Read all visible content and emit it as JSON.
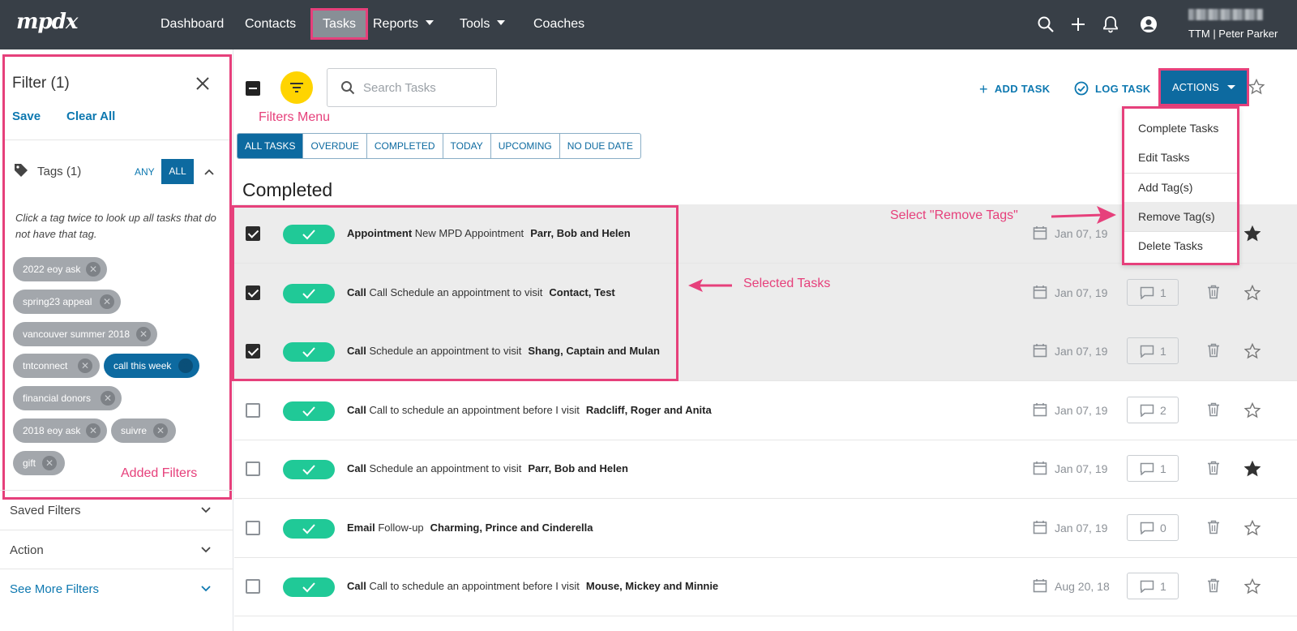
{
  "nav": {
    "logo": "mpdx",
    "items": [
      "Dashboard",
      "Contacts",
      "Tasks",
      "Reports",
      "Tools",
      "Coaches"
    ],
    "account_name": "TTM | Peter Parker",
    "icons": [
      "search-icon",
      "plus-icon",
      "bell-icon",
      "user-icon"
    ]
  },
  "sidebar": {
    "title": "Filter (1)",
    "save": "Save",
    "clear_all": "Clear All",
    "tags_label": "Tags (1)",
    "any": "ANY",
    "all": "ALL",
    "hint": "Click a tag twice to look up all tasks that do not have that tag.",
    "tags": [
      "2022 eoy ask",
      "spring23 appeal",
      "vancouver summer 2018",
      "tntconnect",
      "call this week",
      "financial donors",
      "2018 eoy ask",
      "suivre",
      "gift"
    ],
    "active_tag": "call this week",
    "added_filters_note": "Added Filters",
    "sections": [
      "Saved Filters",
      "Action",
      "See More Filters"
    ]
  },
  "main": {
    "filters_menu_note": "Filters Menu",
    "search_placeholder": "Search Tasks",
    "add_task": "ADD TASK",
    "log_task": "LOG TASK",
    "actions": "ACTIONS",
    "tabs": [
      "ALL TASKS",
      "OVERDUE",
      "COMPLETED",
      "TODAY",
      "UPCOMING",
      "NO DUE DATE"
    ],
    "section_title": "Completed",
    "selected_tasks_note": "Selected Tasks",
    "remove_tags_note": "Select \"Remove Tags\"",
    "dropdown": [
      "Complete Tasks",
      "Edit Tasks",
      "Add Tag(s)",
      "Remove Tag(s)",
      "Delete Tasks"
    ],
    "tasks": [
      {
        "type": "Appointment",
        "subject": "New MPD Appointment",
        "contact": "Parr, Bob and Helen",
        "date": "Jan 07, 19",
        "comments": "",
        "selected": true,
        "starred": true
      },
      {
        "type": "Call",
        "subject": "Call Schedule an appointment to visit",
        "contact": "Contact, Test",
        "date": "Jan 07, 19",
        "comments": "1",
        "selected": true,
        "starred": false
      },
      {
        "type": "Call",
        "subject": "Schedule an appointment to visit",
        "contact": "Shang, Captain and Mulan",
        "date": "Jan 07, 19",
        "comments": "1",
        "selected": true,
        "starred": false
      },
      {
        "type": "Call",
        "subject": "Call to schedule an appointment before I visit",
        "contact": "Radcliff, Roger and Anita",
        "date": "Jan 07, 19",
        "comments": "2",
        "selected": false,
        "starred": false
      },
      {
        "type": "Call",
        "subject": "Schedule an appointment to visit",
        "contact": "Parr, Bob and Helen",
        "date": "Jan 07, 19",
        "comments": "1",
        "selected": false,
        "starred": true
      },
      {
        "type": "Email",
        "subject": "Follow-up",
        "contact": "Charming, Prince and Cinderella",
        "date": "Jan 07, 19",
        "comments": "0",
        "selected": false,
        "starred": false
      },
      {
        "type": "Call",
        "subject": "Call to schedule an appointment before I visit",
        "contact": "Mouse, Mickey and Minnie",
        "date": "Aug 20, 18",
        "comments": "1",
        "selected": false,
        "starred": false
      }
    ]
  },
  "colors": {
    "nav_bg": "#383f47",
    "primary": "#0d6aa0",
    "done": "#20c997",
    "annotation": "#e6407b",
    "fab": "#ffd400"
  }
}
